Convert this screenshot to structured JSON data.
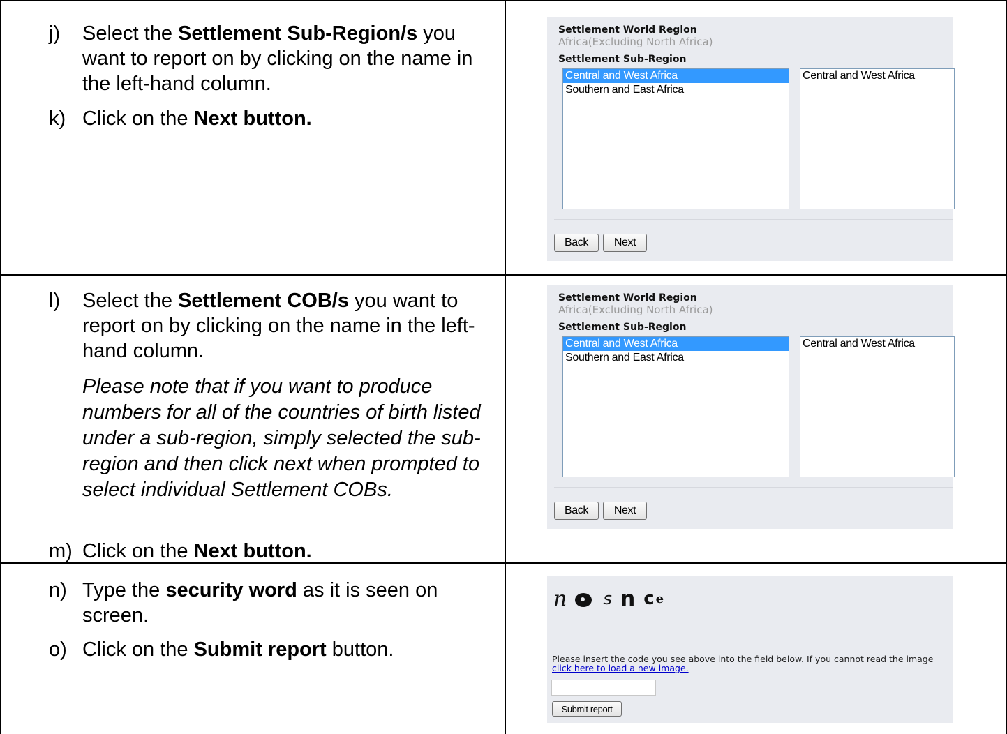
{
  "rows": [
    {
      "steps": [
        {
          "label": "j)",
          "pre": "Select the ",
          "bold": "Settlement Sub-Region/s",
          "post": " you want to report on by clicking on the name in the left-hand column."
        },
        {
          "label": "k)",
          "pre": "Click on the ",
          "bold": "Next button.",
          "post": ""
        }
      ],
      "panel": {
        "world_region_label": "Settlement World Region",
        "world_region_value": "Africa(Excluding North Africa)",
        "sub_region_label": "Settlement Sub-Region",
        "left_list": [
          "Central and West Africa",
          "Southern and East Africa"
        ],
        "selected_index": 0,
        "right_list": [
          "Central and West Africa"
        ],
        "back_label": "Back",
        "next_label": "Next"
      }
    },
    {
      "steps": [
        {
          "label": "l)",
          "pre": "Select the ",
          "bold": "Settlement COB/s",
          "post": " you want to report on by clicking on the name in the left-hand column."
        },
        {
          "label": "m)",
          "pre": "Click on the ",
          "bold": "Next button.",
          "post": ""
        }
      ],
      "note": "Please note that if you want to produce numbers for all of the countries of birth listed under a sub-region, simply selected the sub-region and then click next when prompted to select individual Settlement COBs.",
      "panel": {
        "world_region_label": "Settlement World Region",
        "world_region_value": "Africa(Excluding North Africa)",
        "sub_region_label": "Settlement Sub-Region",
        "left_list": [
          "Central and West Africa",
          "Southern and East Africa"
        ],
        "selected_index": 0,
        "right_list": [
          "Central and West Africa"
        ],
        "back_label": "Back",
        "next_label": "Next"
      }
    },
    {
      "steps": [
        {
          "label": "n)",
          "pre": "Type the ",
          "bold": "security word",
          "post": " as it is seen on screen."
        },
        {
          "label": "o)",
          "pre": "Click on the ",
          "bold": "Submit report",
          "post": " button."
        }
      ],
      "panel": {
        "captcha": "nosnce",
        "instruction_text": "Please insert the code you see above into the field below. If you cannot read the image ",
        "instruction_link": "click here to load a new image.",
        "code_value": "",
        "submit_label": "Submit report"
      }
    }
  ]
}
